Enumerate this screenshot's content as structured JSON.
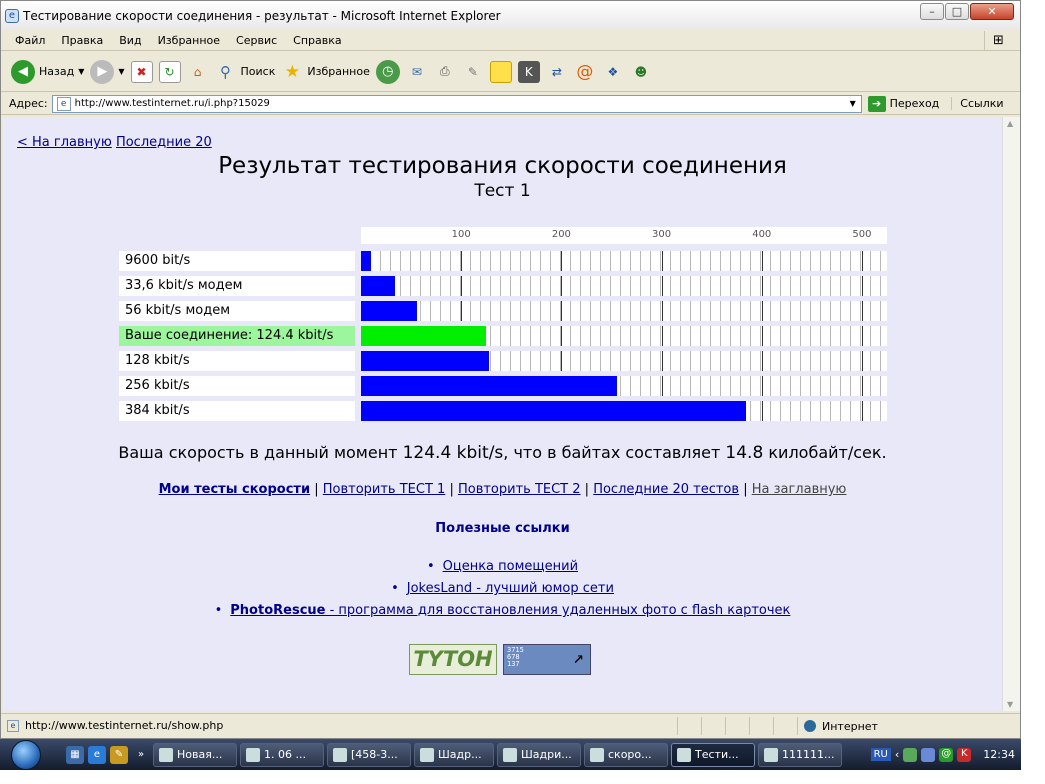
{
  "window": {
    "title": "Тестирование скорости соединения - результат - Microsoft Internet Explorer",
    "buttons": {
      "minimize": "–",
      "maximize": "□",
      "close": "✕"
    }
  },
  "menu": [
    "Файл",
    "Правка",
    "Вид",
    "Избранное",
    "Сервис",
    "Справка"
  ],
  "toolbar": {
    "back_label": "Назад",
    "search_label": "Поиск",
    "favorites_label": "Избранное"
  },
  "address": {
    "label": "Адрес:",
    "url": "http://www.testinternet.ru/i.php?15029",
    "go_label": "Переход",
    "links_label": "Ссылки"
  },
  "page": {
    "nav_home": "< На главную",
    "nav_last20": "Последние 20",
    "title": "Результат тестирования скорости соединения",
    "subtitle": "Тест 1",
    "speed_prefix": "Ваша скорость в данный момент",
    "speed_value": "124.4 kbit/s",
    "speed_middle": ", что в байтах составляет",
    "bytes_value": "14.8",
    "bytes_unit": "килобайт/сек.",
    "links": {
      "my_tests": "Мои тесты скорости",
      "repeat1": "Повторить ТЕСТ 1",
      "repeat2": "Повторить ТЕСТ 2",
      "last20": "Последние 20 тестов",
      "home": "На заглавную",
      "sep": "|"
    },
    "useful_title": "Полезные ссылки",
    "useful": [
      {
        "link": "Оценка помещений",
        "rest": ""
      },
      {
        "link": "JokesLand - лучший юмор сети",
        "rest": ""
      },
      {
        "link": "PhotoRescue",
        "rest": " - программа для восстановления удаленных фото с flash карточек"
      }
    ],
    "badge1": "TYTOH",
    "badge2_lines": [
      "3715",
      "678",
      "137"
    ]
  },
  "chart_data": {
    "type": "bar",
    "orientation": "horizontal",
    "categories": [
      "9600 bit/s",
      "33,6 kbit/s модем",
      "56 kbit/s модем",
      "Ваше соединение: 124.4 kbit/s",
      "128 kbit/s",
      "256 kbit/s",
      "384 kbit/s"
    ],
    "values": [
      9.6,
      33.6,
      56,
      124.4,
      128,
      256,
      384
    ],
    "highlight_index": 3,
    "colors": {
      "bar": "#0000ff",
      "highlight": "#00ee00",
      "highlight_label_bg": "#9cf79c"
    },
    "xticks": [
      100,
      200,
      300,
      400,
      500
    ],
    "xlim": [
      0,
      525
    ],
    "grid": true
  },
  "status": {
    "url": "http://www.testinternet.ru/show.php",
    "zone": "Интернет"
  },
  "taskbar": {
    "tasks": [
      "Новая...",
      "1. 06 ...",
      "[458-3...",
      "Шадр...",
      "Шадри...",
      "скоро...",
      "Тести...",
      "111111..."
    ],
    "active_index": 6,
    "lang": "RU",
    "time": "12:34"
  }
}
